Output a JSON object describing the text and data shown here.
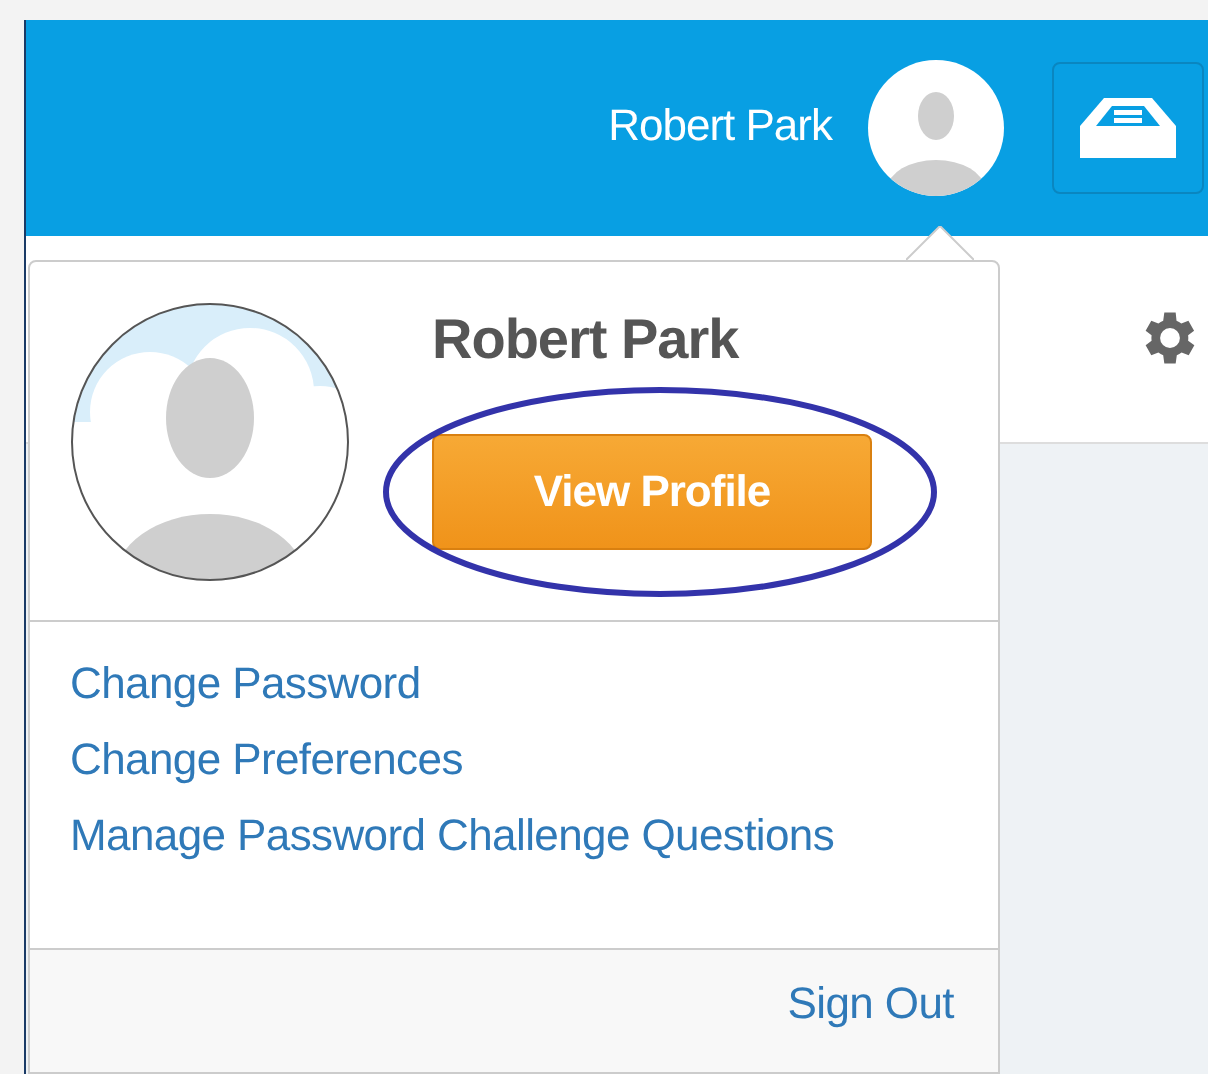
{
  "header": {
    "user_name": "Robert Park"
  },
  "profile_menu": {
    "name": "Robert Park",
    "view_profile_button": "View Profile",
    "highlighted": true,
    "links": [
      "Change Password",
      "Change Preferences",
      "Manage Password Challenge Questions"
    ],
    "sign_out": "Sign Out"
  }
}
